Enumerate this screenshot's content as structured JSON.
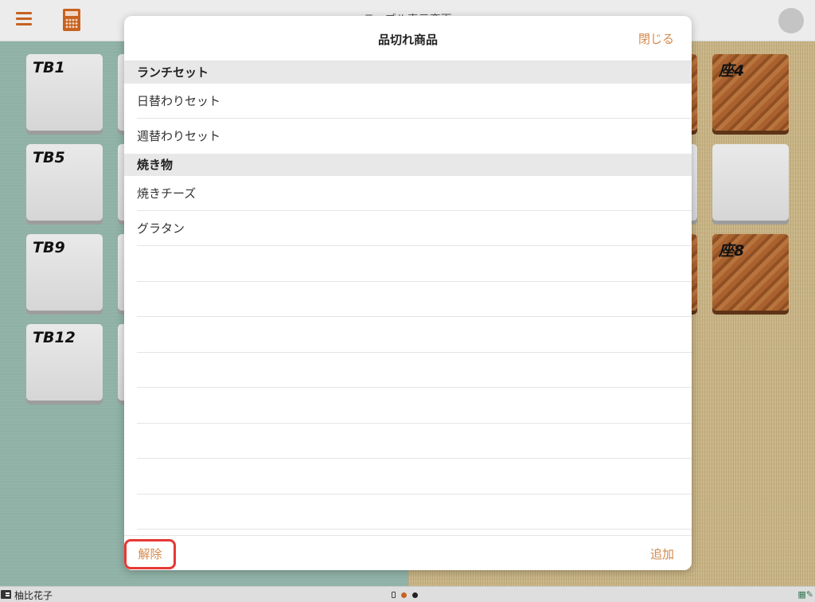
{
  "app": {
    "title": "テーブル表示変更"
  },
  "floor": {
    "left_tiles": [
      "TB1",
      "TB5",
      "TB9",
      "TB12"
    ],
    "right_tiles": [
      "座4",
      "",
      "座8"
    ]
  },
  "modal": {
    "title": "品切れ商品",
    "close_label": "閉じる",
    "sections": [
      {
        "header": "ランチセット",
        "items": [
          "日替わりセット",
          "週替わりセット"
        ]
      },
      {
        "header": "焼き物",
        "items": [
          "焼きチーズ",
          "グラタン"
        ]
      }
    ],
    "release_label": "解除",
    "add_label": "追加"
  },
  "statusbar": {
    "user_name": "柚比花子"
  },
  "colors": {
    "accent": "#d4894b",
    "brand": "#c8621f",
    "highlight_box": "#e53935",
    "page_dot_active": "#c8621f",
    "page_dot_inactive": "#222222"
  },
  "icons": {
    "menu": "hamburger-icon",
    "calculator": "calculator-icon",
    "avatar": "user-avatar-icon",
    "user": "user-card-icon"
  }
}
